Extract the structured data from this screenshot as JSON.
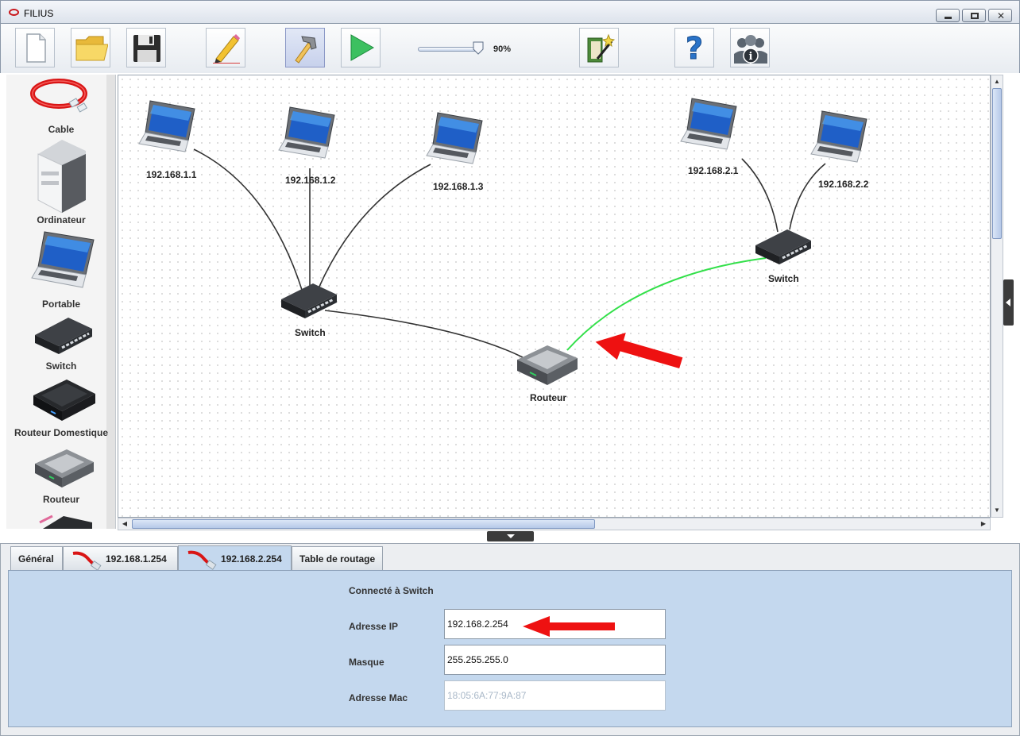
{
  "window": {
    "title": "FILIUS"
  },
  "toolbar": {
    "buttons": [
      {
        "name": "new-file-button",
        "icon": "new-file-icon"
      },
      {
        "name": "open-folder-button",
        "icon": "folder-icon"
      },
      {
        "name": "save-button",
        "icon": "floppy-disk-icon"
      },
      {
        "name": "draft-mode-button",
        "icon": "pencil-icon"
      },
      {
        "name": "design-mode-button",
        "icon": "hammer-icon",
        "active": true
      },
      {
        "name": "simulation-mode-button",
        "icon": "play-icon"
      },
      {
        "name": "wizard-button",
        "icon": "magic-wand-icon"
      },
      {
        "name": "help-button",
        "icon": "question-mark-icon"
      },
      {
        "name": "about-button",
        "icon": "info-people-icon"
      }
    ],
    "zoom": {
      "value_label": "90%",
      "fraction": 0.9
    }
  },
  "palette": {
    "items": [
      {
        "label": "Cable",
        "icon": "cable-icon"
      },
      {
        "label": "Ordinateur",
        "icon": "computer-tower-icon"
      },
      {
        "label": "Portable",
        "icon": "laptop-icon"
      },
      {
        "label": "Switch",
        "icon": "switch-icon"
      },
      {
        "label": "Routeur Domestique",
        "icon": "home-router-icon"
      },
      {
        "label": "Routeur",
        "icon": "router-icon"
      }
    ]
  },
  "canvas": {
    "nodes": [
      {
        "id": "laptop-1",
        "type": "laptop",
        "label": "192.168.1.1"
      },
      {
        "id": "laptop-2",
        "type": "laptop",
        "label": "192.168.1.2"
      },
      {
        "id": "laptop-3",
        "type": "laptop",
        "label": "192.168.1.3"
      },
      {
        "id": "laptop-4",
        "type": "laptop",
        "label": "192.168.2.1"
      },
      {
        "id": "laptop-5",
        "type": "laptop",
        "label": "192.168.2.2"
      },
      {
        "id": "switch-1",
        "type": "switch",
        "label": "Switch"
      },
      {
        "id": "switch-2",
        "type": "switch",
        "label": "Switch"
      },
      {
        "id": "router-1",
        "type": "router",
        "label": "Routeur"
      }
    ],
    "cables": [
      {
        "from": "laptop-1",
        "to": "switch-1",
        "selected": false
      },
      {
        "from": "laptop-2",
        "to": "switch-1",
        "selected": false
      },
      {
        "from": "laptop-3",
        "to": "switch-1",
        "selected": false
      },
      {
        "from": "switch-1",
        "to": "router-1",
        "selected": false
      },
      {
        "from": "router-1",
        "to": "switch-2",
        "selected": true
      },
      {
        "from": "laptop-4",
        "to": "switch-2",
        "selected": false
      },
      {
        "from": "laptop-5",
        "to": "switch-2",
        "selected": false
      }
    ],
    "colors": {
      "cable": "#333333",
      "selected_cable": "#33e04a",
      "annotation_arrow": "#ee1111"
    }
  },
  "panel": {
    "tabs": [
      {
        "label": "Général",
        "active": false,
        "icon": ""
      },
      {
        "label": "192.168.1.254",
        "active": false,
        "icon": "cable-icon"
      },
      {
        "label": "192.168.2.254",
        "active": true,
        "icon": "cable-icon"
      },
      {
        "label": "Table de routage",
        "active": false,
        "icon": ""
      }
    ],
    "connected_to": "Connecté à Switch",
    "fields": {
      "ip": {
        "label": "Adresse IP",
        "value": "192.168.2.254"
      },
      "mask": {
        "label": "Masque",
        "value": "255.255.255.0"
      },
      "mac": {
        "label": "Adresse Mac",
        "value": "18:05:6A:77:9A:87"
      }
    }
  }
}
